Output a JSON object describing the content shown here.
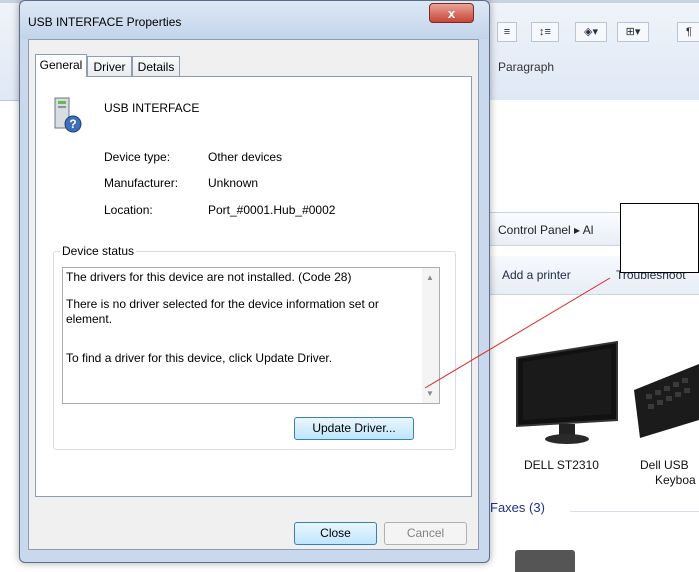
{
  "background": {
    "word_ribbon": {
      "group_label": "Paragraph"
    },
    "control_panel": {
      "breadcrumb": "Control Panel ▸ Al",
      "toolbar": {
        "add_printer": "Add a printer",
        "troubleshoot": "Troubleshoot"
      },
      "devices": [
        {
          "label": "DELL ST2310"
        },
        {
          "label_line1": "Dell USB",
          "label_line2": "Keyboa"
        }
      ],
      "faxes_heading": "Faxes (3)"
    }
  },
  "dialog": {
    "title": "USB INTERFACE Properties",
    "close_glyph": "x",
    "tabs": [
      "General",
      "Driver",
      "Details"
    ],
    "device_name": "USB INTERFACE",
    "properties": [
      {
        "label": "Device type:",
        "value": "Other devices"
      },
      {
        "label": "Manufacturer:",
        "value": "Unknown"
      },
      {
        "label": "Location:",
        "value": "Port_#0001.Hub_#0002"
      }
    ],
    "status_group_label": "Device status",
    "status_lines": [
      "The drivers for this device are not installed. (Code 28)",
      "There is no driver selected for the device information set or element.",
      "To find a driver for this device, click Update Driver."
    ],
    "update_driver_button": "Update Driver...",
    "close_button": "Close",
    "cancel_button": "Cancel"
  },
  "colors": {
    "annotation_line": "#e02020",
    "link_blue": "#1e3287"
  }
}
